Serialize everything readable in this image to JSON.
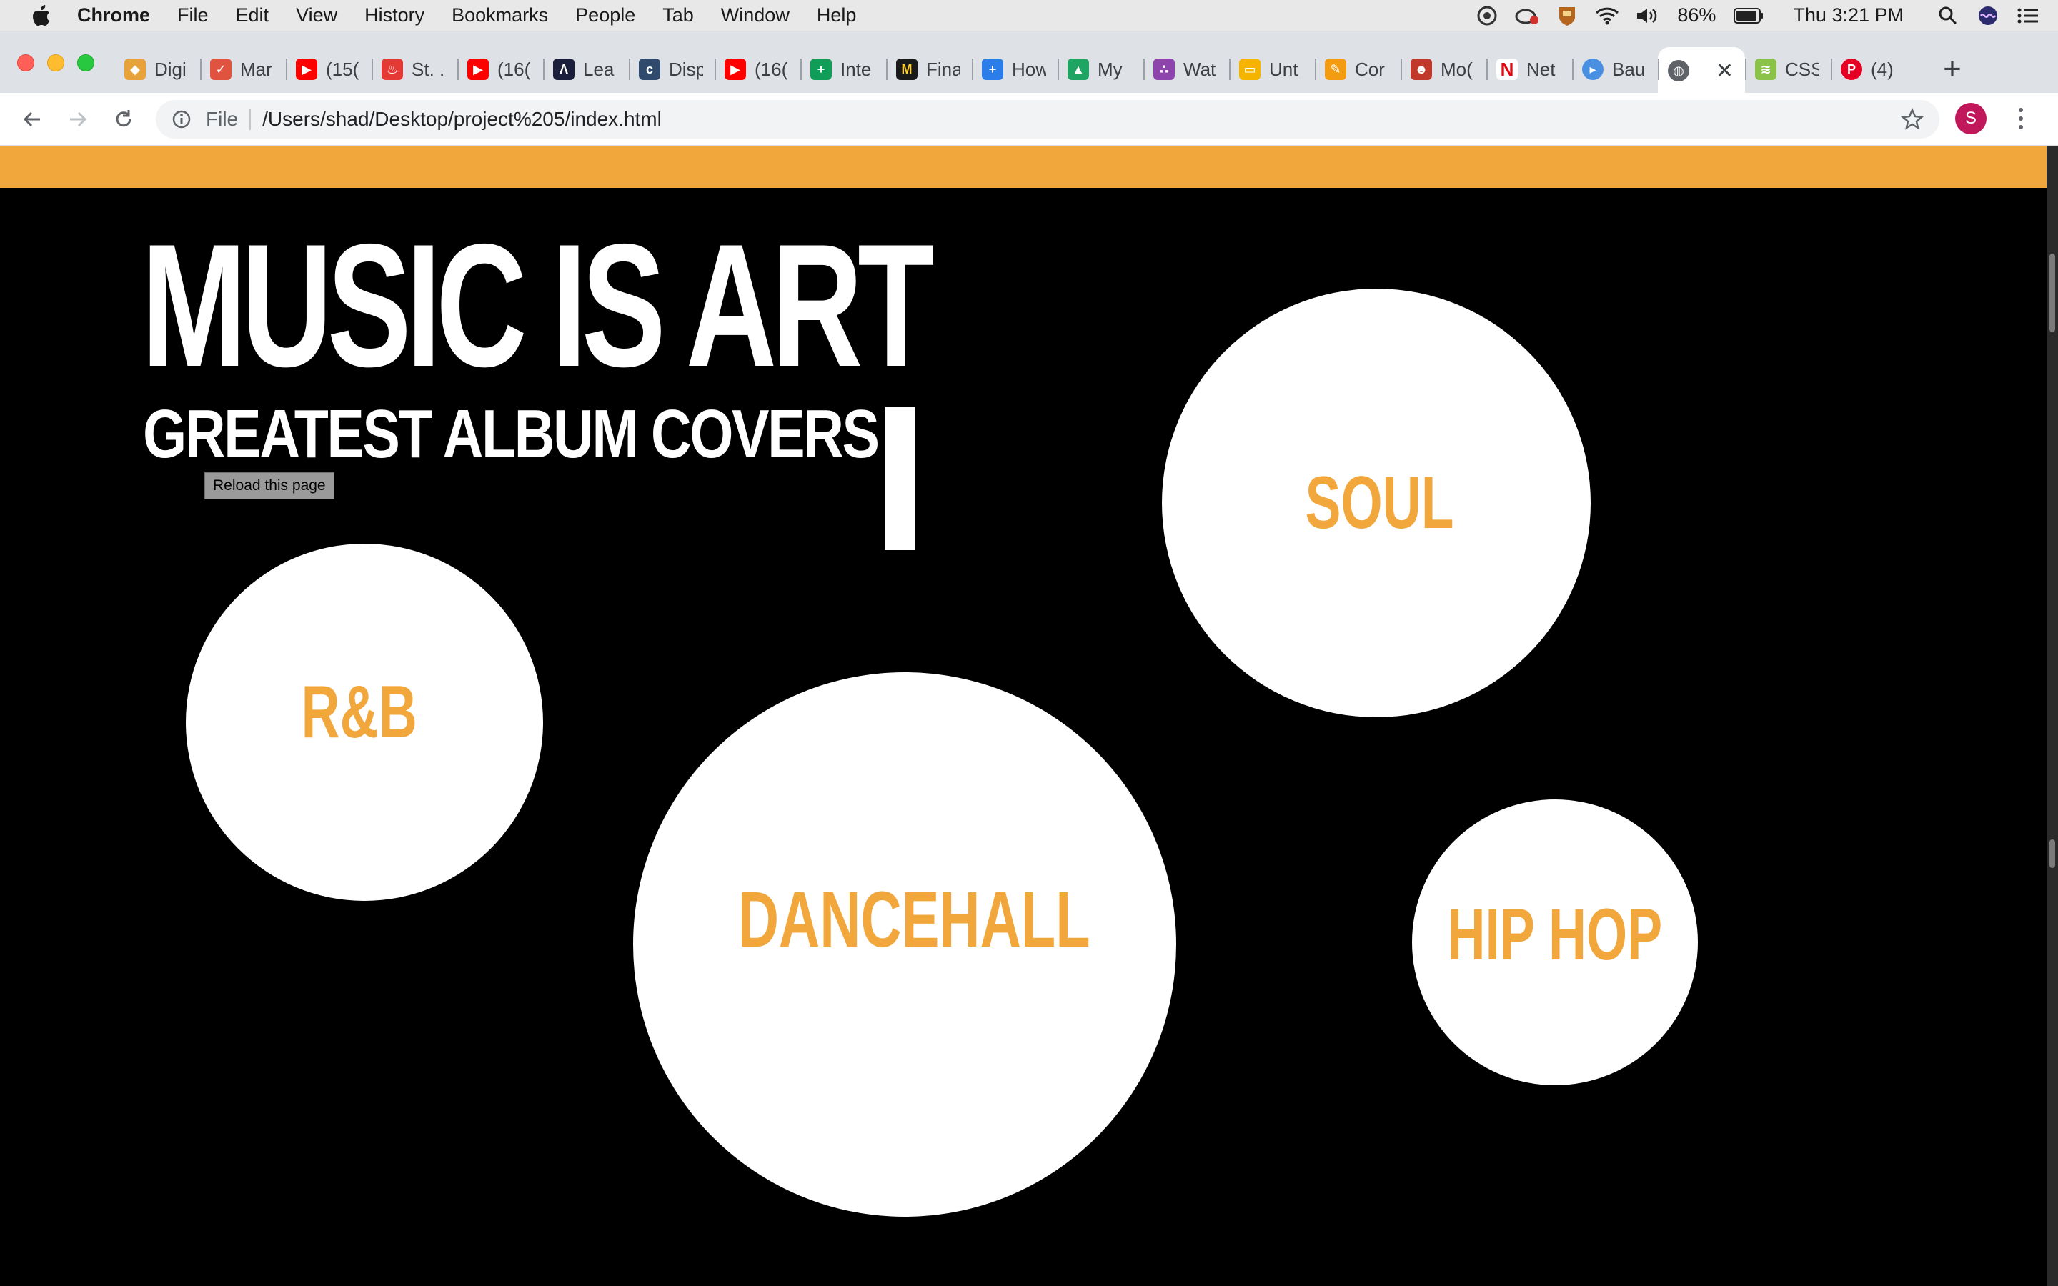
{
  "menubar": {
    "app_name": "Chrome",
    "items": [
      "File",
      "Edit",
      "View",
      "History",
      "Bookmarks",
      "People",
      "Tab",
      "Window",
      "Help"
    ],
    "battery": "86%",
    "clock": "Thu 3:21 PM"
  },
  "tabs": [
    {
      "title": "Digi",
      "icon": "colorful-gem-icon",
      "color": "#e8a23a"
    },
    {
      "title": "Mar",
      "icon": "checkmark-icon",
      "color": "#e0533e"
    },
    {
      "title": "(15(",
      "icon": "youtube-icon",
      "color": "#ff0000"
    },
    {
      "title": "St. .",
      "icon": "flame-icon",
      "color": "#e53935"
    },
    {
      "title": "(16(",
      "icon": "youtube-icon",
      "color": "#ff0000"
    },
    {
      "title": "Lea",
      "icon": "angular-icon",
      "color": "#1b1f3b"
    },
    {
      "title": "Disp",
      "icon": "document-icon",
      "color": "#2f4a6d"
    },
    {
      "title": "(16(",
      "icon": "youtube-icon",
      "color": "#ff0000"
    },
    {
      "title": "Inte",
      "icon": "sheets-icon",
      "color": "#0f9d58"
    },
    {
      "title": "Fina",
      "icon": "miro-icon",
      "color": "#1a1a1a"
    },
    {
      "title": "How",
      "icon": "plus-box-icon",
      "color": "#2b7de9"
    },
    {
      "title": "My",
      "icon": "drive-icon",
      "color": "#1fa463"
    },
    {
      "title": "Wat",
      "icon": "dots-icon",
      "color": "#8e44ad"
    },
    {
      "title": "Unt",
      "icon": "slides-icon",
      "color": "#f4b400"
    },
    {
      "title": "Cor",
      "icon": "pencil-icon",
      "color": "#f39c12"
    },
    {
      "title": "Mo(",
      "icon": "face-icon",
      "color": "#c0392b"
    },
    {
      "title": "Net",
      "icon": "netflix-icon",
      "color": "#e50914"
    },
    {
      "title": "Bau",
      "icon": "play-circle-icon",
      "color": "#4a90e2"
    },
    {
      "title": "",
      "icon": "globe-icon",
      "color": "#5f6368",
      "active": true
    },
    {
      "title": "CSS",
      "icon": "css-icon",
      "color": "#8bc34a"
    },
    {
      "title": "(4)",
      "icon": "pinterest-icon",
      "color": "#e60023"
    }
  ],
  "address_bar": {
    "scheme": "File",
    "url": "/Users/shad/Desktop/project%205/index.html"
  },
  "profile_initial": "S",
  "page": {
    "title": "MUSIC IS ART",
    "subtitle": "GREATEST ALBUM COVERS",
    "tooltip": "Reload this page",
    "accent_color": "#f1a73c",
    "genres": [
      "R&B",
      "DANCEHALL",
      "SOUL",
      "HIP HOP"
    ]
  }
}
